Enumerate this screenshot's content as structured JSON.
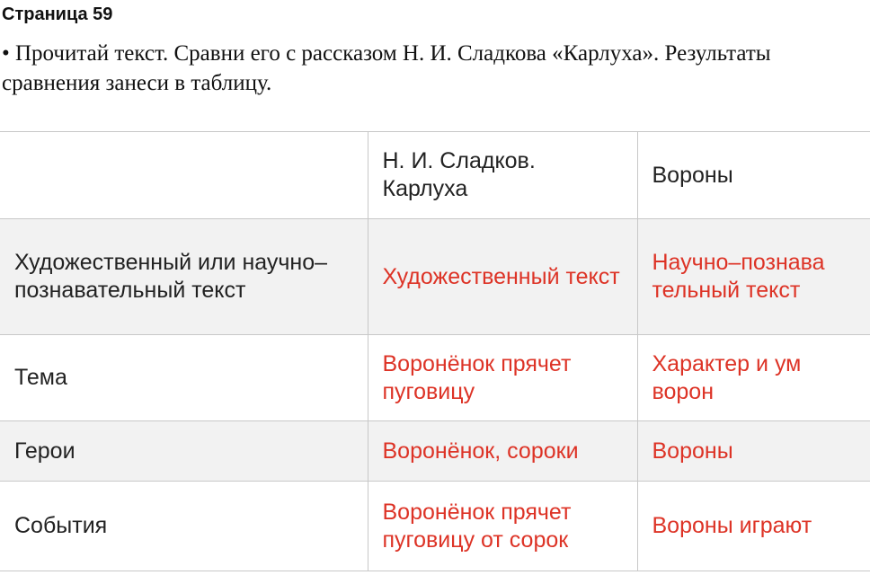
{
  "page": {
    "heading": "Страница 59",
    "task": "• Прочитай текст. Сравни его с рассказом Н. И. Сладкова «Карлуха». Результаты сравнения занеси в таблицу."
  },
  "table": {
    "header": [
      "",
      "Н. И. Сладков. Карлуха",
      "Вороны"
    ],
    "rows": [
      {
        "label": "Художественный или научно–познавательный текст",
        "sladkov": "Художественный текст",
        "crows": "Научно–познава тельный текст"
      },
      {
        "label": "Тема",
        "sladkov": "Воронёнок прячет пуговицу",
        "crows": "Характер и ум ворон"
      },
      {
        "label": "Герои",
        "sladkov": "Воронёнок, сороки",
        "crows": "Вороны"
      },
      {
        "label": "События",
        "sladkov": "Воронёнок прячет пуговицу от сорок",
        "crows": "Вороны играют"
      }
    ]
  },
  "colors": {
    "answer_text": "#dd3326",
    "shaded_row": "#f2f2f2",
    "border": "#c8c8c8"
  }
}
